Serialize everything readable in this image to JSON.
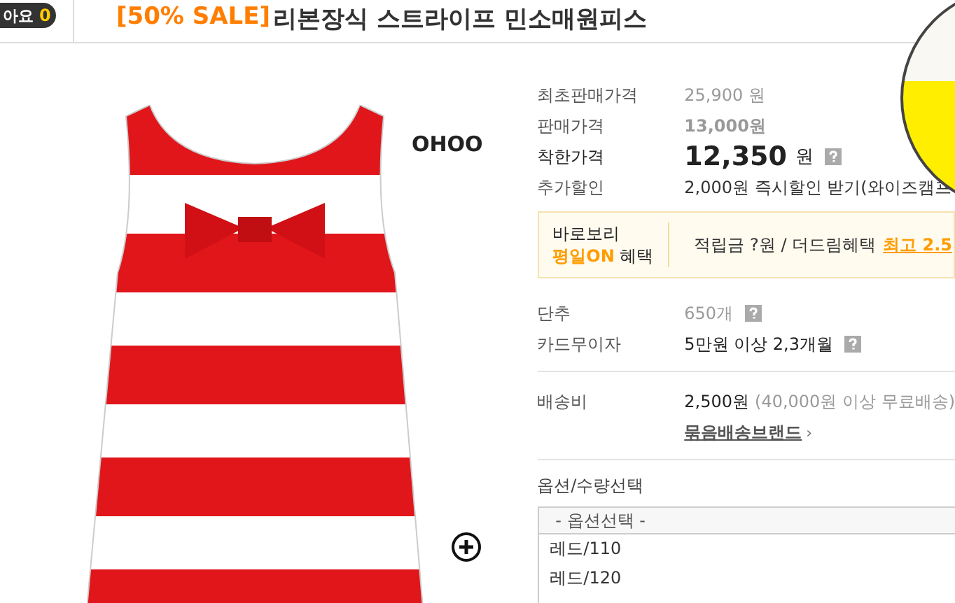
{
  "header": {
    "like_label": "아요",
    "like_count": "0",
    "sale_tag": "[50% SALE]",
    "title": "리본장식 스트라이프 민소매원피스"
  },
  "brand_logo": {
    "name": "OHOO"
  },
  "prices": [
    {
      "kind": "original",
      "label": "최초판매가격",
      "value": "25,900 원"
    },
    {
      "kind": "sale",
      "label": "판매가격",
      "value": "13,000원"
    },
    {
      "kind": "good",
      "label": "착한가격",
      "value": "12,350",
      "unit": "원",
      "help": true
    },
    {
      "kind": "plain",
      "label": "추가할인",
      "value": "2,000원 즉시할인 받기(와이즈캠프"
    }
  ],
  "benefit": {
    "line1": "바로보리",
    "highlight": "평일ON",
    "suffix": "혜택",
    "text": "적립금 ?원 / 더드림혜택",
    "link": "최고 2.5"
  },
  "details": [
    {
      "label": "단추",
      "value": "650개",
      "help": true,
      "dim": true
    },
    {
      "label": "카드무이자",
      "value": "5만원 이상 2,3개월",
      "help": true,
      "dim": false
    }
  ],
  "shipping": {
    "label": "배송비",
    "fee": "2,500원",
    "note": "(40,000원 이상 무료배송)",
    "link": "묶음배송브랜드",
    "link_arrow": "›"
  },
  "options": {
    "label": "옵션/수량선택",
    "header": "- 옵션선택 -",
    "items": [
      "레드/110",
      "레드/120"
    ]
  }
}
